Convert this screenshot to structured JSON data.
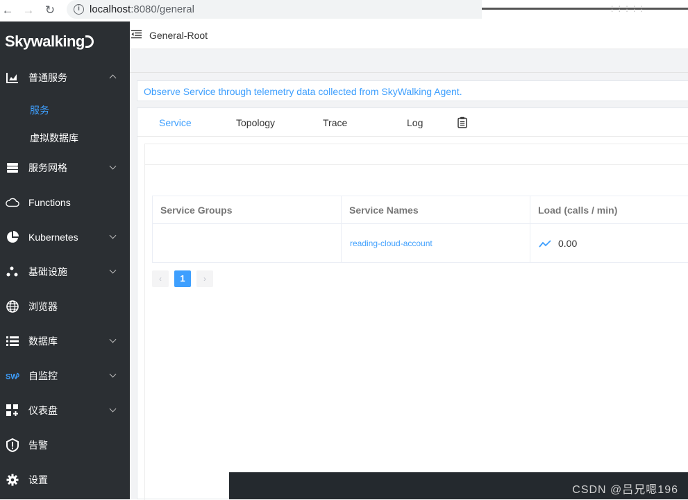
{
  "browser": {
    "url_host": "localhost",
    "url_path": ":8080/general",
    "watermark_top": "⁞ ⁞ ⁞ ⁞ ⁞"
  },
  "sidebar": {
    "logo": "Skywalking",
    "items": [
      {
        "label": "普通服务",
        "icon": "bar-chart-icon",
        "expanded": true
      },
      {
        "label": "服务网格",
        "icon": "layers-icon"
      },
      {
        "label": "Functions",
        "icon": "cloud-icon"
      },
      {
        "label": "Kubernetes",
        "icon": "pie-chart-icon"
      },
      {
        "label": "基础设施",
        "icon": "dots-cluster-icon"
      },
      {
        "label": "浏览器",
        "icon": "globe-icon"
      },
      {
        "label": "数据库",
        "icon": "database-list-icon"
      },
      {
        "label": "自监控",
        "icon": "sw-logo-icon"
      },
      {
        "label": "仪表盘",
        "icon": "dashboard-grid-icon"
      },
      {
        "label": "告警",
        "icon": "alert-shield-icon"
      },
      {
        "label": "设置",
        "icon": "gear-icon"
      }
    ],
    "sub_items": [
      {
        "label": "服务",
        "active": true
      },
      {
        "label": "虚拟数据库",
        "active": false
      }
    ]
  },
  "header": {
    "title": "General-Root"
  },
  "notice": "Observe Service through telemetry data collected from SkyWalking Agent.",
  "tabs": [
    {
      "label": "Service",
      "active": true
    },
    {
      "label": "Topology"
    },
    {
      "label": "Trace"
    },
    {
      "label": "Log"
    }
  ],
  "table": {
    "headers": [
      "Service Groups",
      "Service Names",
      "Load (calls / min)"
    ],
    "rows": [
      {
        "group": "",
        "name": "reading-cloud-account",
        "load": "0.00"
      }
    ]
  },
  "pagination": {
    "prev": "‹",
    "current": "1",
    "next": "›"
  },
  "watermark": "CSDN @吕兄嗯196",
  "colors": {
    "accent": "#3e9ffe",
    "sidebar_bg": "#2b2f33"
  }
}
